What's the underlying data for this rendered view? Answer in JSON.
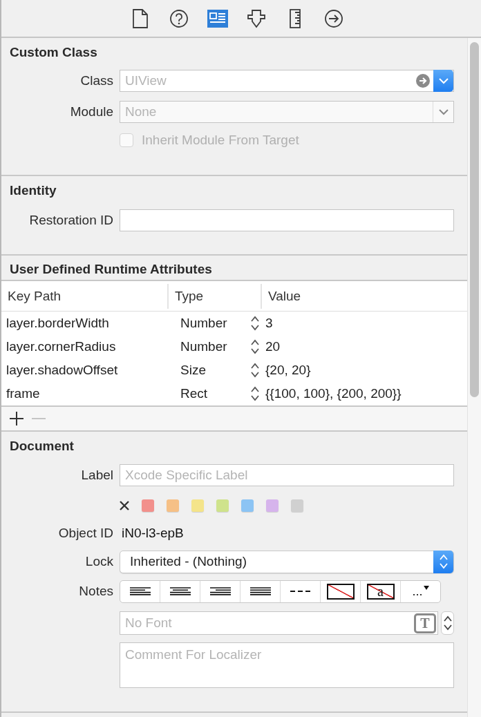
{
  "toolbar": {
    "tabs": [
      {
        "kind": "file",
        "selected": false
      },
      {
        "kind": "help",
        "selected": false
      },
      {
        "kind": "identity",
        "selected": true
      },
      {
        "kind": "attributes",
        "selected": false
      },
      {
        "kind": "size",
        "selected": false
      },
      {
        "kind": "connections",
        "selected": false
      }
    ]
  },
  "custom_class": {
    "title": "Custom Class",
    "class": {
      "label": "Class",
      "placeholder": "UIView"
    },
    "module": {
      "label": "Module",
      "placeholder": "None"
    },
    "inherit": {
      "label": "Inherit Module From Target",
      "checked": false,
      "disabled": true
    }
  },
  "identity": {
    "title": "Identity",
    "restoration": {
      "label": "Restoration ID"
    }
  },
  "runtime_attributes": {
    "title": "User Defined Runtime Attributes",
    "columns": [
      "Key Path",
      "Type",
      "Value"
    ],
    "rows": [
      {
        "key_path": "layer.borderWidth",
        "type": "Number",
        "value": "3"
      },
      {
        "key_path": "layer.cornerRadius",
        "type": "Number",
        "value": "20"
      },
      {
        "key_path": "layer.shadowOffset",
        "type": "Size",
        "value": "{20, 20}"
      },
      {
        "key_path": "frame",
        "type": "Rect",
        "value": "{{100, 100}, {200, 200}}"
      }
    ],
    "remove_disabled": true
  },
  "document": {
    "title": "Document",
    "label": {
      "label": "Label",
      "placeholder": "Xcode Specific Label"
    },
    "colors": [
      {
        "color": "#f2908c"
      },
      {
        "color": "#f6c086"
      },
      {
        "color": "#f4e48a"
      },
      {
        "color": "#cfe38c"
      },
      {
        "color": "#8cc4f4"
      },
      {
        "color": "#d6b4ec"
      },
      {
        "color": "#d0d0d0"
      }
    ],
    "object_id": {
      "label": "Object ID",
      "value": "iN0-l3-epB"
    },
    "lock": {
      "label": "Lock",
      "value": "Inherited - (Nothing)"
    },
    "notes": {
      "label": "Notes",
      "tools": [
        {
          "kind": "align-left"
        },
        {
          "kind": "align-center"
        },
        {
          "kind": "align-right"
        },
        {
          "kind": "justify"
        },
        {
          "kind": "natural"
        },
        {
          "kind": "no-color"
        },
        {
          "kind": "no-text-color",
          "label": "a"
        },
        {
          "kind": "more",
          "label": "..."
        }
      ],
      "font": {
        "placeholder": "No Font",
        "button": "T"
      },
      "comment": {
        "placeholder": "Comment For Localizer"
      }
    }
  }
}
